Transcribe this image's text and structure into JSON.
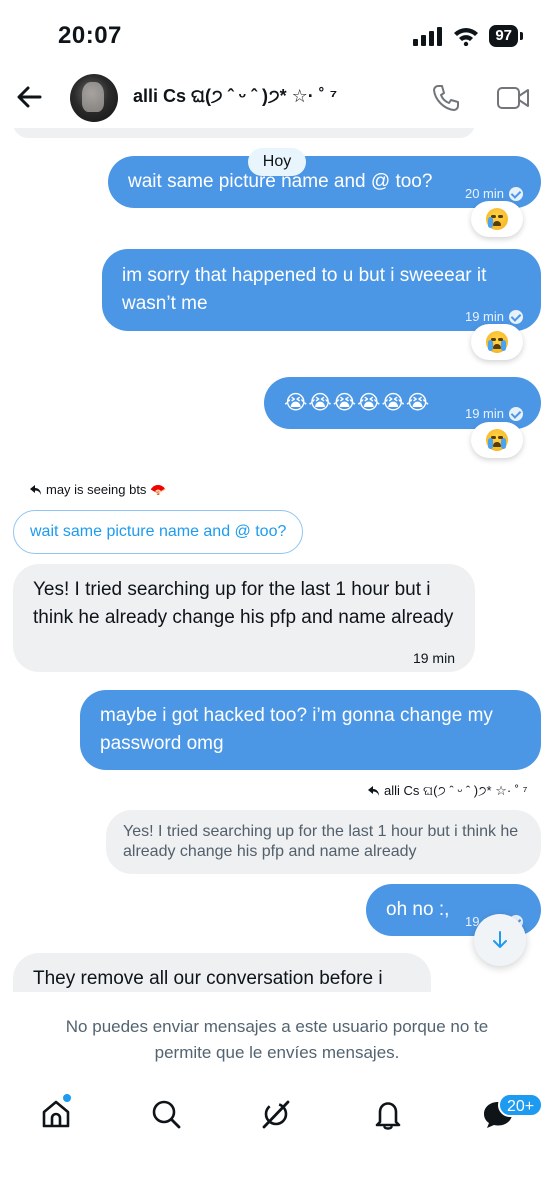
{
  "status_bar": {
    "time": "20:07",
    "battery": "97",
    "icons": [
      "cellular-signal-icon",
      "wifi-icon",
      "battery-icon"
    ]
  },
  "header": {
    "contact_name": "alli Cs ଘ(੭ ˆ ᵕ ˆ )੭* ☆· ˚ ⁷",
    "icons": [
      "back-arrow-icon",
      "phone-icon",
      "video-camera-icon"
    ]
  },
  "thread": {
    "date_chip": "Hoy",
    "messages": [
      {
        "direction": "out",
        "text": "wait same picture name and @ too?",
        "time": "20 min",
        "reaction": "😢"
      },
      {
        "direction": "out",
        "text": "im sorry that happened to u but i sweeear it wasn’t me",
        "time": "19 min",
        "reaction": "😭"
      },
      {
        "direction": "out",
        "text": "😭😭😭😭😭😭",
        "time": "19 min",
        "reaction": "😭"
      },
      {
        "direction": "in",
        "reply_label": "may is seeing bts 🪭",
        "quoted": "wait same picture name and @ too?",
        "text": "Yes! I tried searching up for the last 1 hour but i think he already change his pfp and name already",
        "time": "19 min"
      },
      {
        "direction": "out",
        "text": "maybe i got hacked too? i’m gonna change my password omg"
      },
      {
        "direction": "out",
        "reply_label": "alli Cs ଘ(੭ ˆ ᵕ ˆ )੭* ☆· ˚ ⁷",
        "quoted": "Yes! I tried searching up for the last 1 hour but i think he already change his pfp and name already",
        "text": "oh no :,",
        "time": "19 min"
      },
      {
        "direction": "in",
        "text": "They remove all our conversation before i"
      }
    ]
  },
  "footer_notice": "No puedes enviar mensajes a este usuario porque no te permite que le envíes mensajes.",
  "tabbar": {
    "tabs": [
      "home-icon",
      "search-icon",
      "grok-icon",
      "notifications-icon",
      "messages-icon"
    ],
    "messages_badge": "20+"
  },
  "colors": {
    "outgoing_bubble": "#4c97e5",
    "incoming_bubble": "#eef0f2",
    "accent": "#1d9bf0",
    "muted_text": "#536471"
  }
}
